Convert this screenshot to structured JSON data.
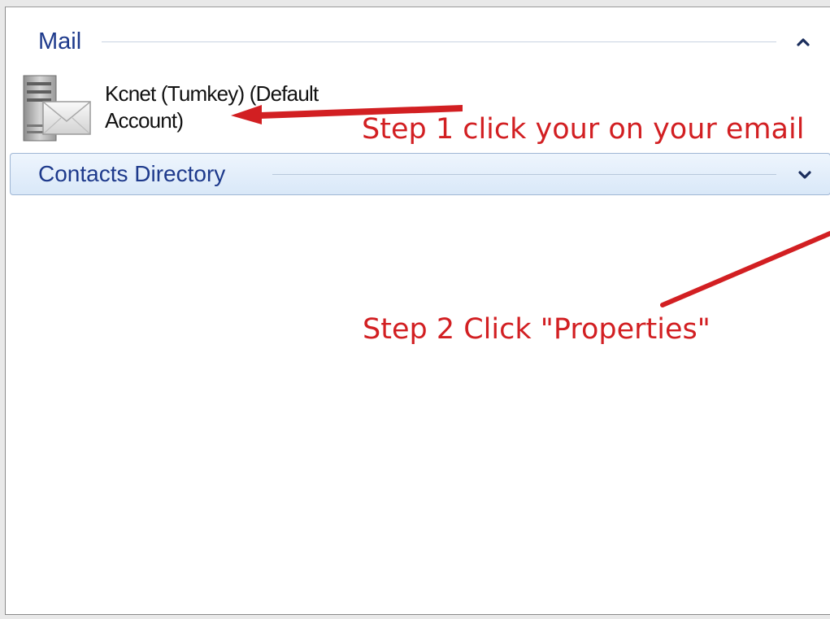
{
  "panel": {
    "mail_section": {
      "title": "Mail",
      "account_name": "Kcnet (Tumkey) (Default Account)"
    },
    "contacts_section": {
      "title": "Contacts Directory"
    }
  },
  "annotations": {
    "step1": "Step 1 click your on your email",
    "step2": "Step 2 Click \"Properties\"",
    "color": "#d21f22"
  },
  "icons": {
    "collapse": "chevron-up-icon",
    "expand": "chevron-down-icon",
    "account": "mail-server-icon"
  },
  "colors": {
    "section_title": "#1e3a8c",
    "contacts_bar_top": "#eef5fd",
    "contacts_bar_bottom": "#d9e8f8"
  }
}
